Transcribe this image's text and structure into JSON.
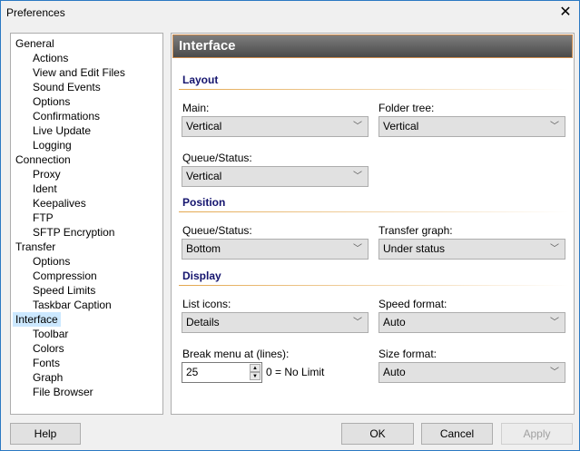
{
  "window": {
    "title": "Preferences"
  },
  "tree": [
    {
      "label": "General",
      "level": 0
    },
    {
      "label": "Actions",
      "level": 1
    },
    {
      "label": "View and Edit Files",
      "level": 1
    },
    {
      "label": "Sound Events",
      "level": 1
    },
    {
      "label": "Options",
      "level": 1
    },
    {
      "label": "Confirmations",
      "level": 1
    },
    {
      "label": "Live Update",
      "level": 1
    },
    {
      "label": "Logging",
      "level": 1
    },
    {
      "label": "Connection",
      "level": 0
    },
    {
      "label": "Proxy",
      "level": 1
    },
    {
      "label": "Ident",
      "level": 1
    },
    {
      "label": "Keepalives",
      "level": 1
    },
    {
      "label": "FTP",
      "level": 1
    },
    {
      "label": "SFTP Encryption",
      "level": 1
    },
    {
      "label": "Transfer",
      "level": 0
    },
    {
      "label": "Options",
      "level": 1
    },
    {
      "label": "Compression",
      "level": 1
    },
    {
      "label": "Speed Limits",
      "level": 1
    },
    {
      "label": "Taskbar Caption",
      "level": 1
    },
    {
      "label": "Interface",
      "level": 0,
      "selected": true
    },
    {
      "label": "Toolbar",
      "level": 1
    },
    {
      "label": "Colors",
      "level": 1
    },
    {
      "label": "Fonts",
      "level": 1
    },
    {
      "label": "Graph",
      "level": 1
    },
    {
      "label": "File Browser",
      "level": 1
    }
  ],
  "panel": {
    "title": "Interface",
    "layout": {
      "heading": "Layout",
      "main_label": "Main:",
      "main_value": "Vertical",
      "folder_label": "Folder tree:",
      "folder_value": "Vertical",
      "queue_label": "Queue/Status:",
      "queue_value": "Vertical"
    },
    "position": {
      "heading": "Position",
      "queue_label": "Queue/Status:",
      "queue_value": "Bottom",
      "graph_label": "Transfer graph:",
      "graph_value": "Under status"
    },
    "display": {
      "heading": "Display",
      "icons_label": "List icons:",
      "icons_value": "Details",
      "speed_label": "Speed format:",
      "speed_value": "Auto",
      "break_label": "Break menu at (lines):",
      "break_value": "25",
      "break_hint": "0 = No Limit",
      "size_label": "Size format:",
      "size_value": "Auto"
    }
  },
  "buttons": {
    "help": "Help",
    "ok": "OK",
    "cancel": "Cancel",
    "apply": "Apply"
  }
}
